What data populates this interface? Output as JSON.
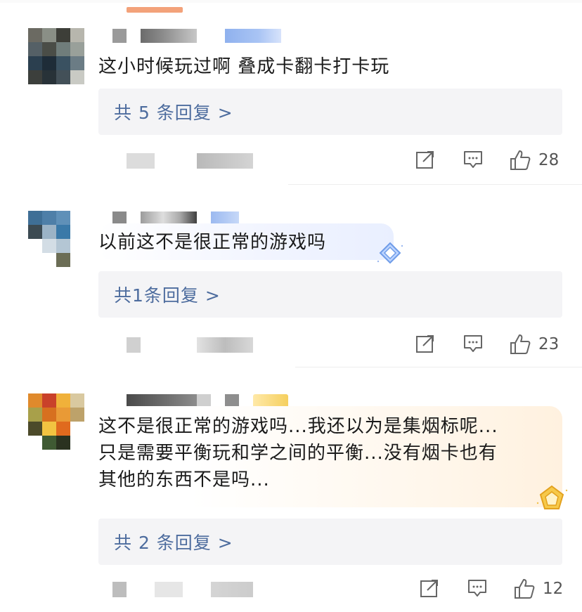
{
  "comments": [
    {
      "text": "这小时候玩过啊 叠成卡翻卡打卡玩",
      "reply_link": "共 5 条回复 >",
      "likes": "28"
    },
    {
      "text": "以前这不是很正常的游戏吗",
      "reply_link": "共1条回复 >",
      "likes": "23"
    },
    {
      "text_lines": [
        "这不是很正常的游戏吗...我还以为是集烟标呢...",
        "只是需要平衡玩和学之间的平衡...没有烟卡也有",
        "其他的东西不是吗..."
      ],
      "reply_link": "共 2 条回复 >",
      "likes": "12"
    }
  ],
  "colors": {
    "reply_link": "#4d6c9e",
    "reply_box": "#f4f4f6",
    "icon": "#666666"
  },
  "icons": [
    "share-icon",
    "comment-icon",
    "like-icon",
    "diamond-badge-icon",
    "gold-badge-icon"
  ]
}
